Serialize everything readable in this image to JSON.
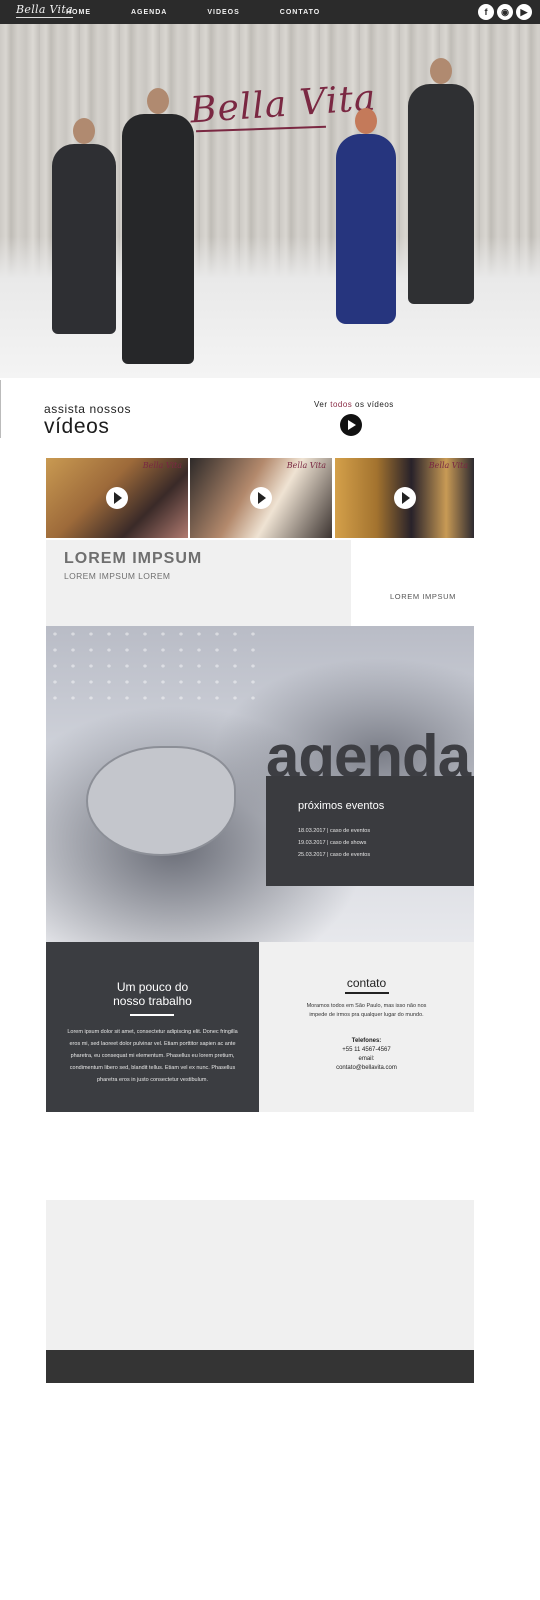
{
  "nav": {
    "logo": "Bella Vita",
    "items": [
      {
        "label": "HOME"
      },
      {
        "label": "AGENDA"
      },
      {
        "label": "VIDEOS"
      },
      {
        "label": "CONTATO"
      }
    ],
    "social": [
      "facebook-icon",
      "instagram-icon",
      "youtube-icon"
    ]
  },
  "hero": {
    "brand": "Bella Vita"
  },
  "videos": {
    "subtitle": "assista nossos",
    "title": "vídeos",
    "see_all_prefix": "Ver ",
    "see_all_highlight": "todos",
    "see_all_suffix": " os vídeos",
    "thumb_tag": "Bella Vita"
  },
  "lorem": {
    "title": "LOREM IMPSUM",
    "subtitle": "LOREM IMPSUM LOREM",
    "side": "LOREM IMPSUM"
  },
  "agenda": {
    "word": "agenda",
    "heading": "próximos eventos",
    "events": [
      {
        "text": "18.03.2017  |  caso de eventos"
      },
      {
        "text": "19.03.2017  |  caso de shows"
      },
      {
        "text": "25.03.2017  |  caso de eventos"
      }
    ]
  },
  "trabalho": {
    "title_line1": "Um pouco do",
    "title_line2": "nosso trabalho",
    "body": "Lorem ipsum dolor sit amet, consectetur adipiscing elit. Donec fringilla eros mi, sed laoreet dolor pulvinar vel. Etiam porttitor sapien ac ante pharetra, eu consequat mi elementum. Phasellus eu lorem pretium, condimentum libero sed, blandit tellus. Etiam vel ex nunc. Phasellus pharetra eros in justo consectetur vestibulum."
  },
  "contato": {
    "title": "contato",
    "text": "Moramos todos em São Paulo, mas isso não nos impede de irmos pra qualquer lugar do mundo.",
    "phones_label": "Telefones:",
    "phone": "+55 11 4567-4567",
    "email_label": "email:",
    "email": "contato@bellavita.com"
  },
  "colors": {
    "nav_bg": "#2b2b2b",
    "brand": "#7a2842",
    "dark_panel": "#3b3d41",
    "light_panel": "#f0f0f0"
  }
}
